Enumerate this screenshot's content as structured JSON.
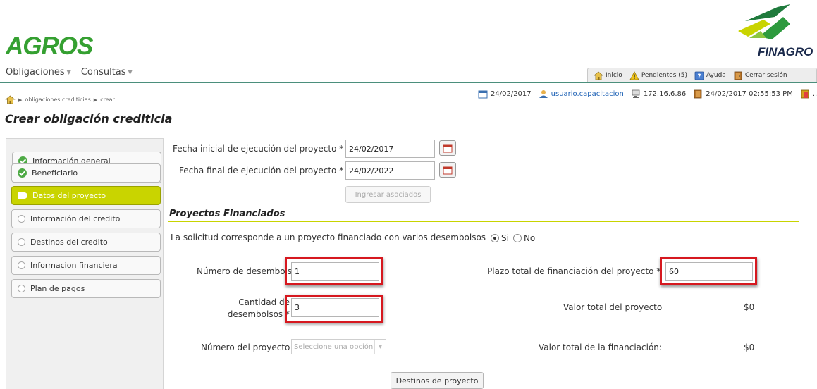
{
  "header": {
    "app_logo": "AGROS",
    "org_logo": "FINAGRO",
    "menu": [
      {
        "label": "Obligaciones"
      },
      {
        "label": "Consultas"
      }
    ],
    "toolbar": {
      "inicio": "Inicio",
      "pendientes": "Pendientes (5)",
      "ayuda": "Ayuda",
      "cerrar": "Cerrar sesión"
    }
  },
  "status": {
    "date": "24/02/2017",
    "user": "usuario.capacitacion",
    "ip": "172.16.6.86",
    "datetime": "24/02/2017 02:55:53 PM",
    "more": "..."
  },
  "breadcrumb": {
    "item1": "obligaciones crediticias",
    "item2": "crear"
  },
  "page_title": "Crear obligación crediticia",
  "sidebar": {
    "items": [
      {
        "label": "Información general",
        "state": "done"
      },
      {
        "label": "Beneficiario",
        "state": "done"
      },
      {
        "label": "Datos del proyecto",
        "state": "active"
      },
      {
        "label": "Información del credito",
        "state": "pending"
      },
      {
        "label": "Destinos del credito",
        "state": "pending"
      },
      {
        "label": "Informacion financiera",
        "state": "pending"
      },
      {
        "label": "Plan de pagos",
        "state": "pending"
      }
    ]
  },
  "form": {
    "fecha_inicial_label": "Fecha inicial de ejecución del proyecto",
    "fecha_inicial_value": "24/02/2017",
    "fecha_final_label": "Fecha final de ejecución del proyecto",
    "fecha_final_value": "24/02/2022",
    "required_mark": "*",
    "ingresar_asociados": "Ingresar asociados",
    "section_title": "Proyectos Financiados",
    "question": "La solicitud corresponde a un proyecto financiado con varios desembolsos",
    "opt_si": "Si",
    "opt_no": "No",
    "numero_desembolso_label": "Número de desembolso",
    "numero_desembolso_value": "1",
    "cantidad_label_1": "Cantidad de",
    "cantidad_label_2": "desembolsos",
    "cantidad_value": "3",
    "numero_proyecto_label": "Número del proyecto",
    "numero_proyecto_placeholder": "Seleccione una opción",
    "plazo_label": "Plazo total de financiación del proyecto",
    "plazo_value": "60",
    "valor_total_label": "Valor total del proyecto",
    "valor_total_value": "$0",
    "valor_financiacion_label": "Valor total de la financiación:",
    "valor_financiacion_value": "$0",
    "destinos_button": "Destinos de proyecto"
  },
  "colors": {
    "accent": "#c9d400",
    "brand_green": "#35a031",
    "highlight": "#d6181f"
  }
}
